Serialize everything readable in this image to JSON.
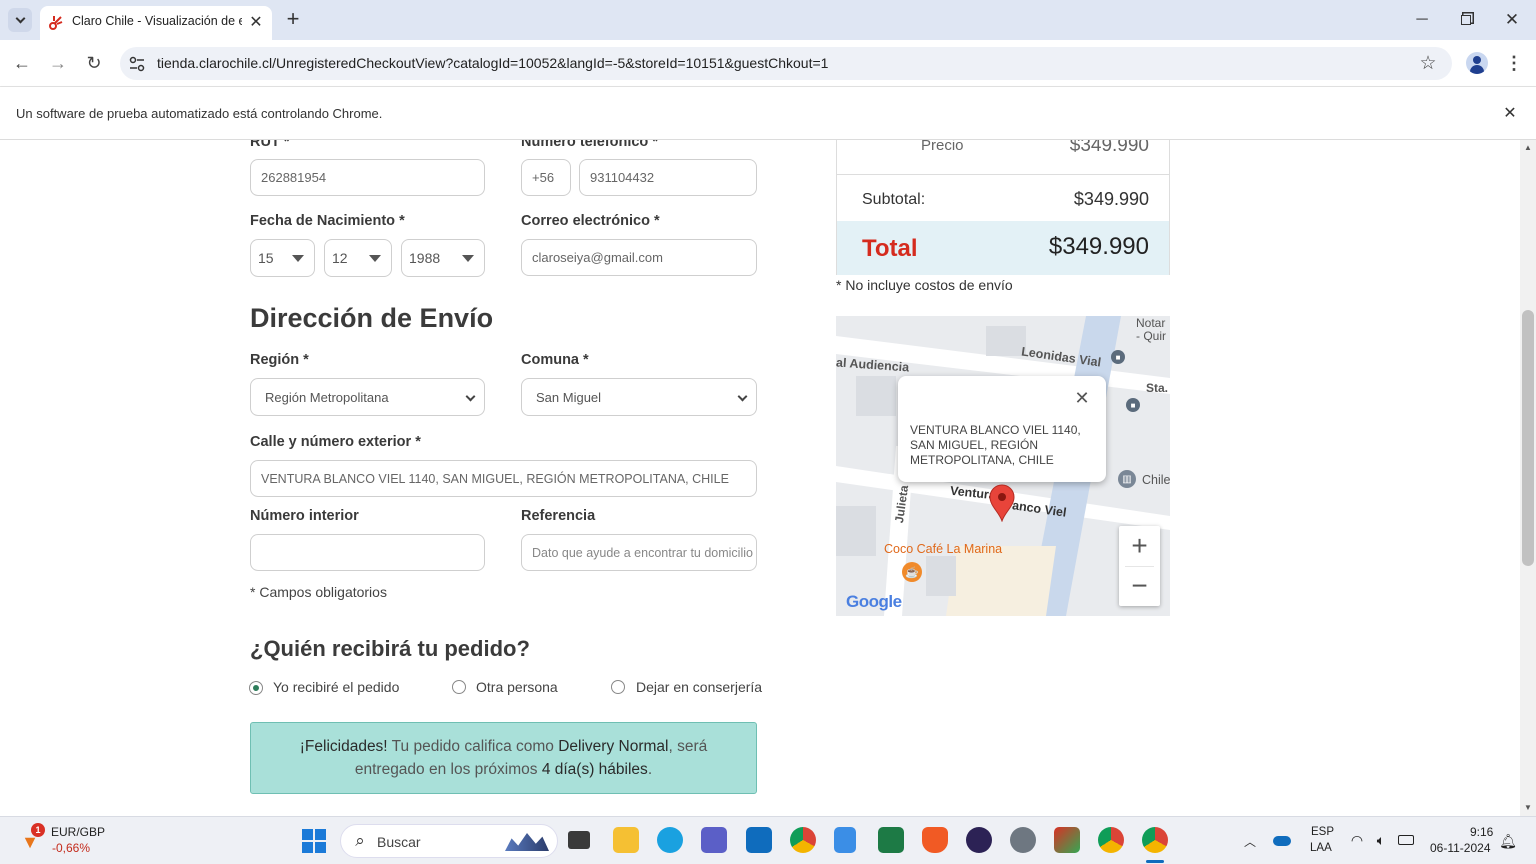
{
  "browser": {
    "tab_title": "Claro Chile - Visualización de e",
    "new_tab": "+",
    "url": "tienda.clarochile.cl/UnregisteredCheckoutView?catalogId=10052&langId=-5&storeId=10151&guestChkout=1",
    "infobar_text": "Un software de prueba automatizado está controlando Chrome."
  },
  "form": {
    "rut_label": "RUT *",
    "rut_value": "262881954",
    "phone_label": "Número telefónico *",
    "phone_prefix": "+56",
    "phone_value": "931104432",
    "birth_label": "Fecha de Nacimiento *",
    "birth_day": "15",
    "birth_month": "12",
    "birth_year": "1988",
    "email_label": "Correo electrónico *",
    "email_value": "claroseiya@gmail.com",
    "shipping_title": "Dirección de Envío",
    "region_label": "Región *",
    "region_value": "Región Metropolitana",
    "comuna_label": "Comuna *",
    "comuna_value": "San Miguel",
    "street_label": "Calle y número exterior *",
    "street_value": "VENTURA BLANCO VIEL 1140, SAN MIGUEL, REGIÓN METROPOLITANA, CHILE",
    "interior_label": "Número interior",
    "interior_value": "",
    "reference_label": "Referencia",
    "reference_placeholder": "Dato que ayude a encontrar tu domicilio",
    "required_note": "* Campos obligatorios",
    "receiver_title": "¿Quién recibirá tu pedido?",
    "receiver_options": [
      "Yo recibiré el pedido",
      "Otra persona",
      "Dejar en conserjería"
    ],
    "delivery_congrats": "¡Felicidades!",
    "delivery_text1": " Tu pedido califica como ",
    "delivery_type": "Delivery Normal",
    "delivery_text2": ", será",
    "delivery_text3": "entregado en los próximos ",
    "delivery_days": "4 día(s) hábiles",
    "delivery_text4": "."
  },
  "summary": {
    "price_label": "Precio",
    "price_value": "$349.990",
    "subtotal_label": "Subtotal:",
    "subtotal_value": "$349.990",
    "total_label": "Total",
    "total_value": "$349.990",
    "shipping_note": "* No incluye costos de envío",
    "accent_red": "#d52b1e",
    "total_bg": "#e3f1f6"
  },
  "map": {
    "streets": [
      "Leonidas Vial",
      "al Audiencia",
      "Ventura",
      "anco Viel",
      "Julieta",
      "Sta.",
      "Notar",
      "- Quir",
      "Chile",
      "Coco Café La Marina",
      "Google"
    ],
    "popup_text": "VENTURA BLANCO VIEL 1140, SAN MIGUEL, REGIÓN METROPOLITANA, CHILE",
    "zoom_in": "+",
    "zoom_out": "−"
  },
  "taskbar": {
    "ticker_name": "EUR/GBP",
    "ticker_change": "-0,66%",
    "ticker_badge": "1",
    "search_label": "Buscar",
    "lang1": "ESP",
    "lang2": "LAA",
    "time": "9:16",
    "date": "06-11-2024"
  }
}
